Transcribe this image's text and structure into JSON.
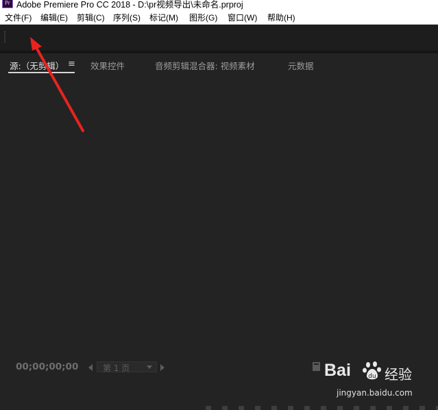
{
  "window": {
    "title": "Adobe Premiere Pro CC 2018 - D:\\pr视频导出\\未命名.prproj",
    "logo_text": "Pr"
  },
  "menu": [
    {
      "label": "文件(F)"
    },
    {
      "label": "编辑(E)"
    },
    {
      "label": "剪辑(C)"
    },
    {
      "label": "序列(S)"
    },
    {
      "label": "标记(M)"
    },
    {
      "label": "图形(G)"
    },
    {
      "label": "窗口(W)"
    },
    {
      "label": "帮助(H)"
    }
  ],
  "tabs": [
    {
      "label": "源:（无剪辑）",
      "active": true
    },
    {
      "label": "效果控件",
      "active": false
    },
    {
      "label": "音频剪辑混合器: 视频素材",
      "active": false
    },
    {
      "label": "元数据",
      "active": false
    }
  ],
  "tab_menu_icon": "≡",
  "source_monitor": {
    "timecode": "00;00;00;00",
    "page_select": "第 1 页"
  },
  "annotation": {
    "color": "#e8231f",
    "icon": "red-arrow"
  },
  "watermark": {
    "brand": "Bai",
    "brand_suffix": "经验",
    "url": "jingyan.baidu.com"
  },
  "colors": {
    "panel_bg": "#232323",
    "toolbar_bg": "#1d1d1d",
    "tab_active": "#e2e2e2",
    "tab_inactive": "#9c9c9c"
  }
}
